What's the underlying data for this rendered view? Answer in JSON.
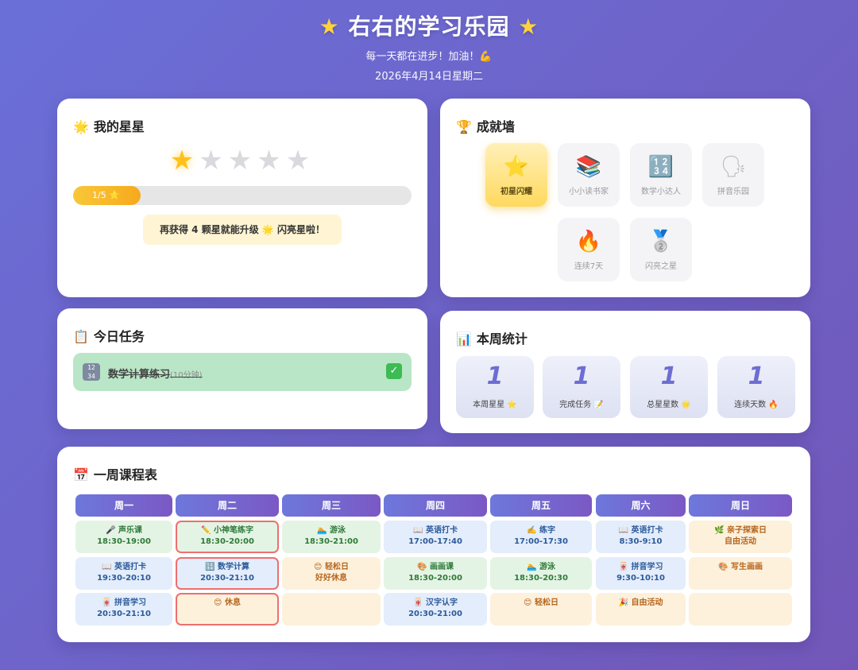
{
  "header": {
    "title": "右右的学习乐园",
    "star_glyph": "★",
    "subtitle": "每一天都在进步！加油！💪",
    "date": "2026年4月14日星期二"
  },
  "stars": {
    "title_emoji": "🌟",
    "title": "我的星星",
    "earned": 1,
    "total": 5,
    "progress_label": "1/5 ⭐",
    "progress_fraction": 0.2,
    "hint": "再获得 4 颗星就能升级 🌟 闪亮星啦！"
  },
  "achievements": {
    "title_emoji": "🏆",
    "title": "成就墙",
    "items": [
      {
        "icon": "⭐",
        "label": "初星闪耀",
        "unlocked": true
      },
      {
        "icon": "📚",
        "label": "小小读书家",
        "unlocked": false
      },
      {
        "icon": "🔢",
        "label": "数学小达人",
        "unlocked": false
      },
      {
        "icon": "🗣",
        "label": "拼音乐园",
        "unlocked": false
      },
      {
        "icon": "🔥",
        "label": "连续7天",
        "unlocked": false
      },
      {
        "icon": "🥈",
        "label": "闪亮之星",
        "unlocked": false
      }
    ]
  },
  "tasks": {
    "title_emoji": "📋",
    "title": "今日任务",
    "items": [
      {
        "icon_text": "12 34",
        "name": "数学计算练习",
        "duration": "(10分钟)",
        "done": true,
        "check": "✓"
      }
    ]
  },
  "stats": {
    "title_emoji": "📊",
    "title": "本周统计",
    "items": [
      {
        "value": "1",
        "label": "本周星星 ⭐"
      },
      {
        "value": "1",
        "label": "完成任务 📝"
      },
      {
        "value": "1",
        "label": "总星星数 🌟"
      },
      {
        "value": "1",
        "label": "连续天数 🔥"
      }
    ]
  },
  "schedule": {
    "title_emoji": "📅",
    "title": "一周课程表",
    "days": [
      "周一",
      "周二",
      "周三",
      "周四",
      "周五",
      "周六",
      "周日"
    ],
    "today_index": 1,
    "rows": [
      [
        {
          "name": "🎤 声乐课",
          "time": "18:30-19:00",
          "color": "green"
        },
        {
          "name": "✏️ 小神笔练字",
          "time": "18:30-20:00",
          "color": "green"
        },
        {
          "name": "🏊 游泳",
          "time": "18:30-21:00",
          "color": "green"
        },
        {
          "name": "📖 英语打卡",
          "time": "17:00-17:40",
          "color": "blue"
        },
        {
          "name": "✍️ 练字",
          "time": "17:00-17:30",
          "color": "blue"
        },
        {
          "name": "📖 英语打卡",
          "time": "8:30-9:10",
          "color": "blue"
        },
        {
          "name": "🌿 亲子探索日",
          "time": "自由活动",
          "color": "orange"
        }
      ],
      [
        {
          "name": "📖 英语打卡",
          "time": "19:30-20:10",
          "color": "blue"
        },
        {
          "name": "🔢 数学计算",
          "time": "20:30-21:10",
          "color": "blue"
        },
        {
          "name": "😊 轻松日",
          "time": "好好休息",
          "color": "orange"
        },
        {
          "name": "🎨 画画课",
          "time": "18:30-20:00",
          "color": "green"
        },
        {
          "name": "🏊 游泳",
          "time": "18:30-20:30",
          "color": "green"
        },
        {
          "name": "🀄 拼音学习",
          "time": "9:30-10:10",
          "color": "blue"
        },
        {
          "name": "🎨 写生画画",
          "time": "",
          "color": "orange"
        }
      ],
      [
        {
          "name": "🀄 拼音学习",
          "time": "20:30-21:10",
          "color": "blue"
        },
        {
          "name": "😊 休息",
          "time": "",
          "color": "orange"
        },
        {
          "name": "",
          "time": "",
          "color": "empty"
        },
        {
          "name": "🀄 汉字认字",
          "time": "20:30-21:00",
          "color": "blue"
        },
        {
          "name": "😊 轻松日",
          "time": "",
          "color": "orange"
        },
        {
          "name": "🎉 自由活动",
          "time": "",
          "color": "orange"
        },
        {
          "name": "",
          "time": "",
          "color": "empty"
        }
      ]
    ]
  }
}
